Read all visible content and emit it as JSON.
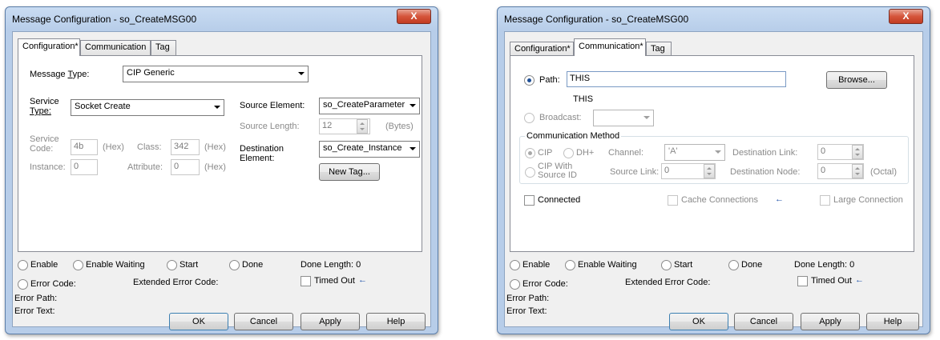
{
  "dialog_title": "Message Configuration - so_CreateMSG00",
  "close_glyph": "X",
  "left": {
    "tabs": [
      "Configuration*",
      "Communication",
      "Tag"
    ],
    "message_type_label": "Message ",
    "message_type_label_u": "T",
    "message_type_label_rest": "ype:",
    "message_type_value": "CIP Generic",
    "service_type_label_1": "Service",
    "service_type_label_2": "Type:",
    "service_type_value": "Socket Create",
    "service_code_label_1": "Service",
    "service_code_label_2": "Code:",
    "service_code_value": "4b",
    "hex1": "(Hex)",
    "class_label": "Class:",
    "class_value": "342",
    "hex2": "(Hex)",
    "instance_label": "Instance:",
    "instance_value": "0",
    "attribute_label": "Attribute:",
    "attribute_value": "0",
    "hex3": "(Hex)",
    "source_element_label": "Source Element:",
    "source_element_value": "so_CreateParameter",
    "source_length_label": "Source Length:",
    "source_length_value": "12",
    "bytes_label": "(Bytes)",
    "destination_label_1": "Destination",
    "destination_label_2": "Element:",
    "destination_value": "so_Create_Instance",
    "new_tag_button": "New Tag..."
  },
  "right": {
    "tabs": [
      "Configuration*",
      "Communication*",
      "Tag"
    ],
    "path_label": "Path:",
    "path_value": "THIS",
    "path_resolved": "THIS",
    "browse_button": "Browse...",
    "broadcast_label": "Broadcast:",
    "comm_method_title": "Communication Method",
    "cip_label": "CIP",
    "dh_label": "DH+",
    "channel_label": "Channel:",
    "channel_value": "'A'",
    "dest_link_label": "Destination Link:",
    "dest_link_value": "0",
    "cip_with_label_1": "CIP With",
    "cip_with_label_2": "Source ID",
    "source_link_label": "Source Link:",
    "source_link_value": "0",
    "dest_node_label": "Destination Node:",
    "dest_node_value": "0",
    "octal_label": "(Octal)",
    "connected_label": "Connected",
    "cache_label": "Cache Connections",
    "large_label": "Large Connection"
  },
  "status": {
    "enable": "Enable",
    "enable_waiting": "Enable Waiting",
    "start": "Start",
    "done": "Done",
    "done_length": "Done Length: 0",
    "error_code": "Error Code:",
    "extended_error_code": "Extended Error Code:",
    "timed_out": "Timed Out",
    "error_path": "Error Path:",
    "error_text": "Error Text:",
    "arrow_glyph": "←"
  },
  "buttons": {
    "ok": "OK",
    "cancel": "Cancel",
    "apply": "Apply",
    "help": "Help"
  }
}
